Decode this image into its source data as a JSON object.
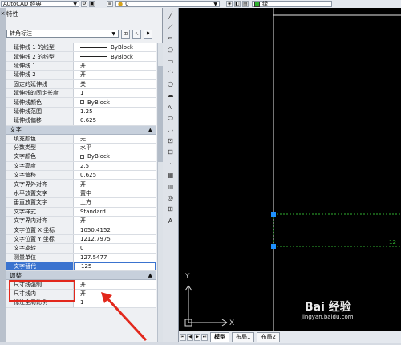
{
  "toolbar": {
    "workspace": "AutoCAD 经典",
    "layer_value": "0",
    "color_value": "绿"
  },
  "panel": {
    "title": "特性",
    "object_type": "转角标注"
  },
  "lines_props": [
    {
      "label": "延伸线 1 的线型",
      "value": "ByBlock",
      "line": true
    },
    {
      "label": "延伸线 2 的线型",
      "value": "ByBlock",
      "line": true
    },
    {
      "label": "延伸线 1",
      "value": "开"
    },
    {
      "label": "延伸线 2",
      "value": "开"
    },
    {
      "label": "固定的延伸线",
      "value": "关"
    },
    {
      "label": "延伸线的固定长度",
      "value": "1"
    },
    {
      "label": "延伸线颜色",
      "value": "ByBlock",
      "swatch": true
    },
    {
      "label": "延伸线范围",
      "value": "1.25"
    },
    {
      "label": "延伸线偏移",
      "value": "0.625"
    }
  ],
  "text_section": {
    "title": "文字",
    "rows": [
      {
        "label": "填充颜色",
        "value": "无"
      },
      {
        "label": "分数类型",
        "value": "水平"
      },
      {
        "label": "文字颜色",
        "value": "ByBlock",
        "swatch": true
      },
      {
        "label": "文字高度",
        "value": "2.5"
      },
      {
        "label": "文字偏移",
        "value": "0.625"
      },
      {
        "label": "文字界外对齐",
        "value": "开"
      },
      {
        "label": "水平放置文字",
        "value": "置中"
      },
      {
        "label": "垂直放置文字",
        "value": "上方"
      },
      {
        "label": "文字样式",
        "value": "Standard"
      },
      {
        "label": "文字界内对齐",
        "value": "开"
      },
      {
        "label": "文字位置 X 坐标",
        "value": "1050.4152"
      },
      {
        "label": "文字位置 Y 坐标",
        "value": "1212.7975"
      },
      {
        "label": "文字旋转",
        "value": "0"
      },
      {
        "label": "测量单位",
        "value": "127.5477"
      },
      {
        "label": "文字替代",
        "value": "125"
      }
    ]
  },
  "fit_section": {
    "title": "调整",
    "rows": [
      {
        "label": "尺寸线强制",
        "value": "开"
      },
      {
        "label": "尺寸线内",
        "value": "开"
      },
      {
        "label": "标注全局比例",
        "value": "1"
      }
    ]
  },
  "layout_tabs": [
    "模型",
    "布局1",
    "布局2"
  ],
  "drawing": {
    "dim_text_partial": "12",
    "ucs_x": "X",
    "ucs_y": "Y"
  },
  "watermark": {
    "text": "Bai 经验",
    "url": "jingyan.baidu.com"
  },
  "colors": {
    "selected_row": "#3a73cf",
    "annotation_red": "#e2281c",
    "layer_green": "#2fb12f",
    "grip_blue": "#1e90ff"
  }
}
